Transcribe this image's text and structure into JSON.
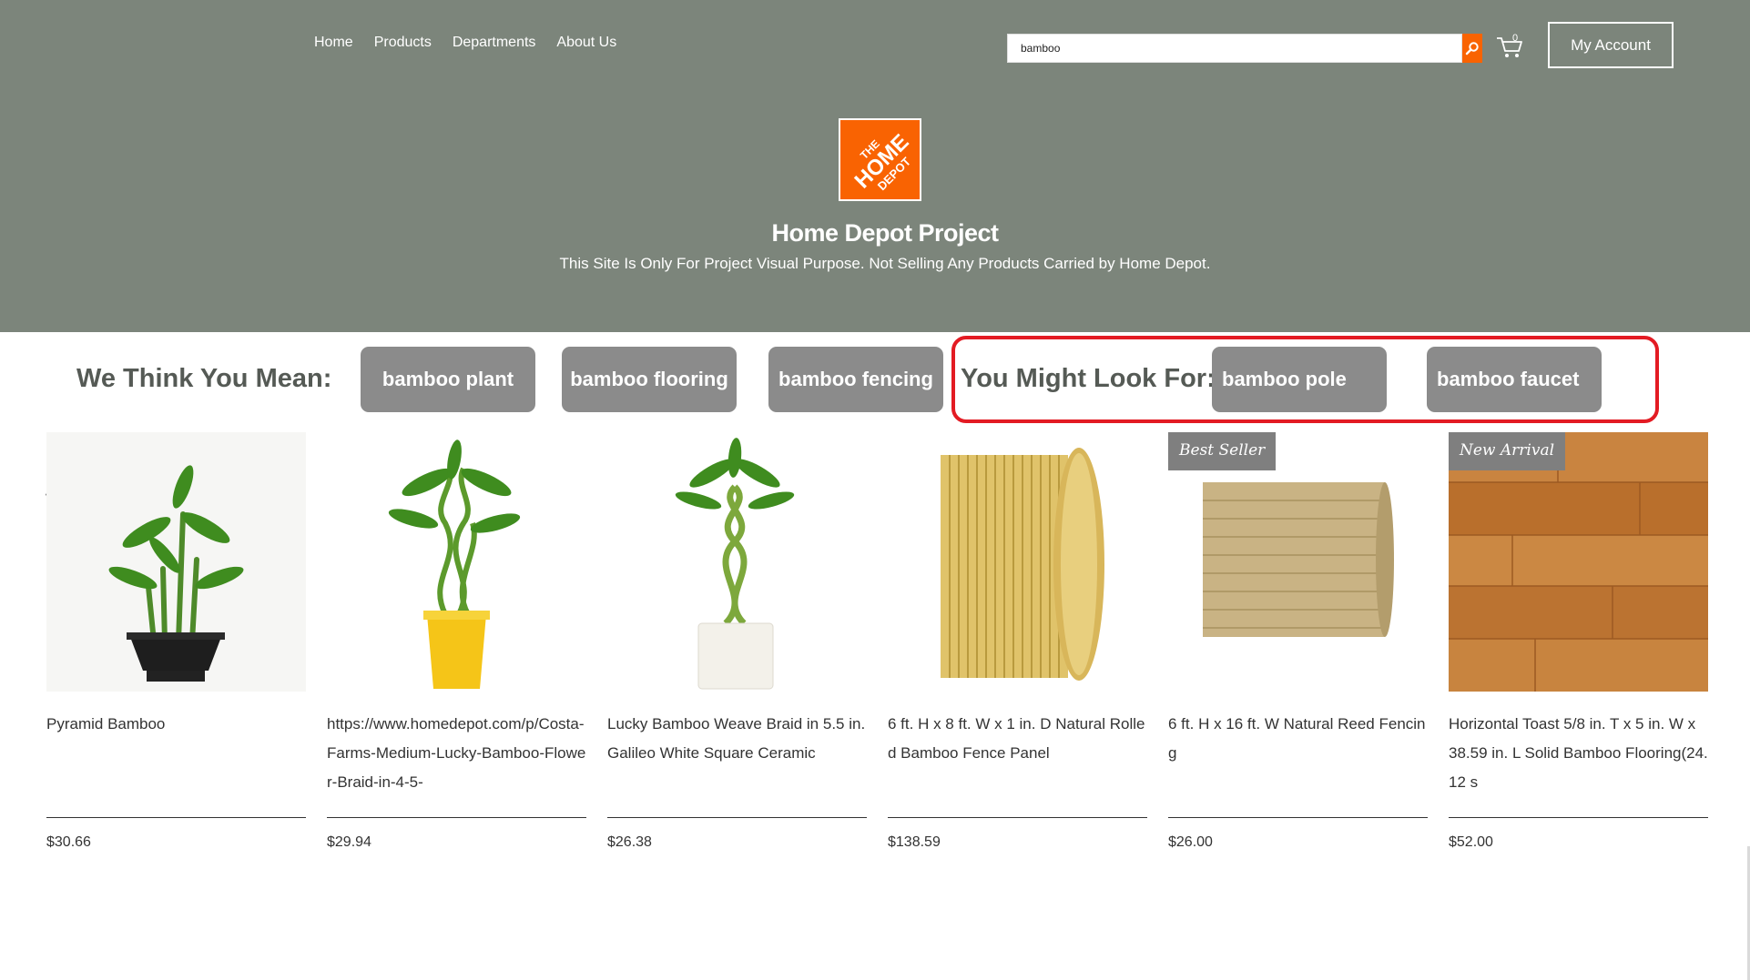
{
  "nav": {
    "items": [
      "Home",
      "Products",
      "Departments",
      "About Us"
    ]
  },
  "search": {
    "value": "bamboo",
    "placeholder": ""
  },
  "cart": {
    "count": "0"
  },
  "account": {
    "label": "My Account"
  },
  "brand": {
    "title": "Home Depot Project",
    "subtitle": "This Site Is Only For Project Visual Purpose. Not Selling Any Products Carried by Home Depot.",
    "logo_text": [
      "THE",
      "HOME",
      "DEPOT"
    ],
    "logo_color": "#f96302"
  },
  "suggestions": {
    "label": "We Think You Mean:",
    "items": [
      "bamboo plant",
      "bamboo flooring",
      "bamboo fencing"
    ]
  },
  "related": {
    "label": "You Might Look For:",
    "items": [
      "bamboo pole",
      "bamboo faucet"
    ],
    "highlight_color": "#e31b23"
  },
  "gallery": {
    "prev_icon": "‹",
    "next_icon": "›",
    "products": [
      {
        "name": "Pyramid Bamboo",
        "price": "$30.66",
        "badge": ""
      },
      {
        "name": "https://www.homedepot.com/p/Costa-Farms-Medium-Lucky-Bamboo-Flower-Braid-in-4-5-",
        "price": "$29.94",
        "badge": ""
      },
      {
        "name": "Lucky Bamboo Weave Braid in 5.5 in. Galileo White Square Ceramic",
        "price": "$26.38",
        "badge": ""
      },
      {
        "name": "6 ft. H x 8 ft. W x 1 in. D Natural Rolled Bamboo Fence Panel",
        "price": "$138.59",
        "badge": ""
      },
      {
        "name": "6 ft. H x 16 ft. W Natural Reed Fencing",
        "price": "$26.00",
        "badge": "Best Seller"
      },
      {
        "name": "Horizontal Toast 5/8 in. T x 5 in. W x 38.59 in. L Solid Bamboo Flooring(24.12 s",
        "price": "$52.00",
        "badge": "New Arrival"
      }
    ]
  },
  "colors": {
    "header_bg": "#7c857b",
    "chip_bg": "#8b8b8b",
    "accent": "#f96302"
  }
}
